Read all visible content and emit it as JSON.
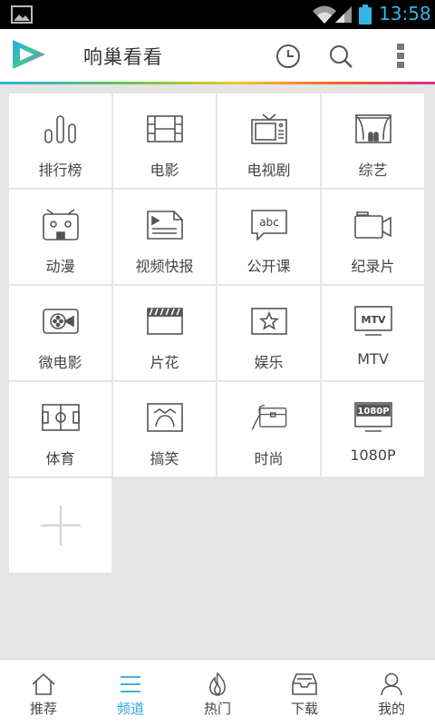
{
  "status_bar": {
    "time": "13:58",
    "time_color": "#33b5e5"
  },
  "app_bar": {
    "title": "响巢看看"
  },
  "grid": {
    "items": [
      {
        "label": "排行榜",
        "icon": "ranking-icon"
      },
      {
        "label": "电影",
        "icon": "film-icon"
      },
      {
        "label": "电视剧",
        "icon": "tv-icon"
      },
      {
        "label": "综艺",
        "icon": "stage-icon"
      },
      {
        "label": "动漫",
        "icon": "anime-icon"
      },
      {
        "label": "视频快报",
        "icon": "newsreel-icon"
      },
      {
        "label": "公开课",
        "icon": "abc-icon"
      },
      {
        "label": "纪录片",
        "icon": "camera-icon"
      },
      {
        "label": "微电影",
        "icon": "micro-film-icon"
      },
      {
        "label": "片花",
        "icon": "clapper-icon"
      },
      {
        "label": "娱乐",
        "icon": "star-icon"
      },
      {
        "label": "MTV",
        "icon": "mtv-icon",
        "icon_text": "MTV"
      },
      {
        "label": "体育",
        "icon": "field-icon"
      },
      {
        "label": "搞笑",
        "icon": "laugh-icon"
      },
      {
        "label": "时尚",
        "icon": "bag-icon"
      },
      {
        "label": "1080P",
        "icon": "hd-icon",
        "icon_text": "1080P"
      }
    ],
    "add_tile": {
      "icon": "plus-icon"
    }
  },
  "bottom_nav": {
    "active_color": "#29a8e0",
    "items": [
      {
        "label": "推荐",
        "icon": "home-icon"
      },
      {
        "label": "频道",
        "icon": "menu-icon",
        "active": true
      },
      {
        "label": "热门",
        "icon": "flame-icon"
      },
      {
        "label": "下载",
        "icon": "tray-icon"
      },
      {
        "label": "我的",
        "icon": "user-icon"
      }
    ]
  }
}
